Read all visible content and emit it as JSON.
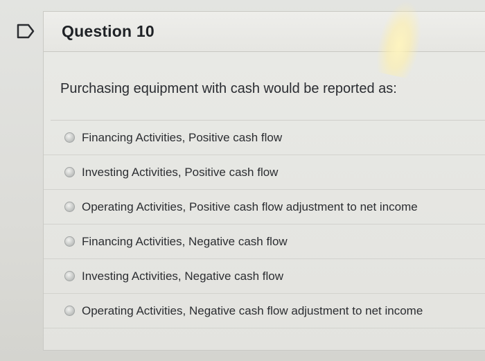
{
  "question": {
    "title": "Question 10",
    "prompt": "Purchasing equipment with cash would be reported as:"
  },
  "options": [
    {
      "label": "Financing Activities, Positive cash flow",
      "selected": false
    },
    {
      "label": "Investing Activities, Positive cash flow",
      "selected": false
    },
    {
      "label": "Operating Activities, Positive cash flow adjustment to net income",
      "selected": false
    },
    {
      "label": "Financing Activities, Negative cash flow",
      "selected": false
    },
    {
      "label": "Investing Activities, Negative cash flow",
      "selected": false
    },
    {
      "label": "Operating Activities, Negative cash flow adjustment to net income",
      "selected": false
    }
  ],
  "icons": {
    "flag": "flag-icon"
  },
  "colors": {
    "flag_stroke": "#2b2d31",
    "title": "#1f2226",
    "text": "#2b2d31"
  }
}
